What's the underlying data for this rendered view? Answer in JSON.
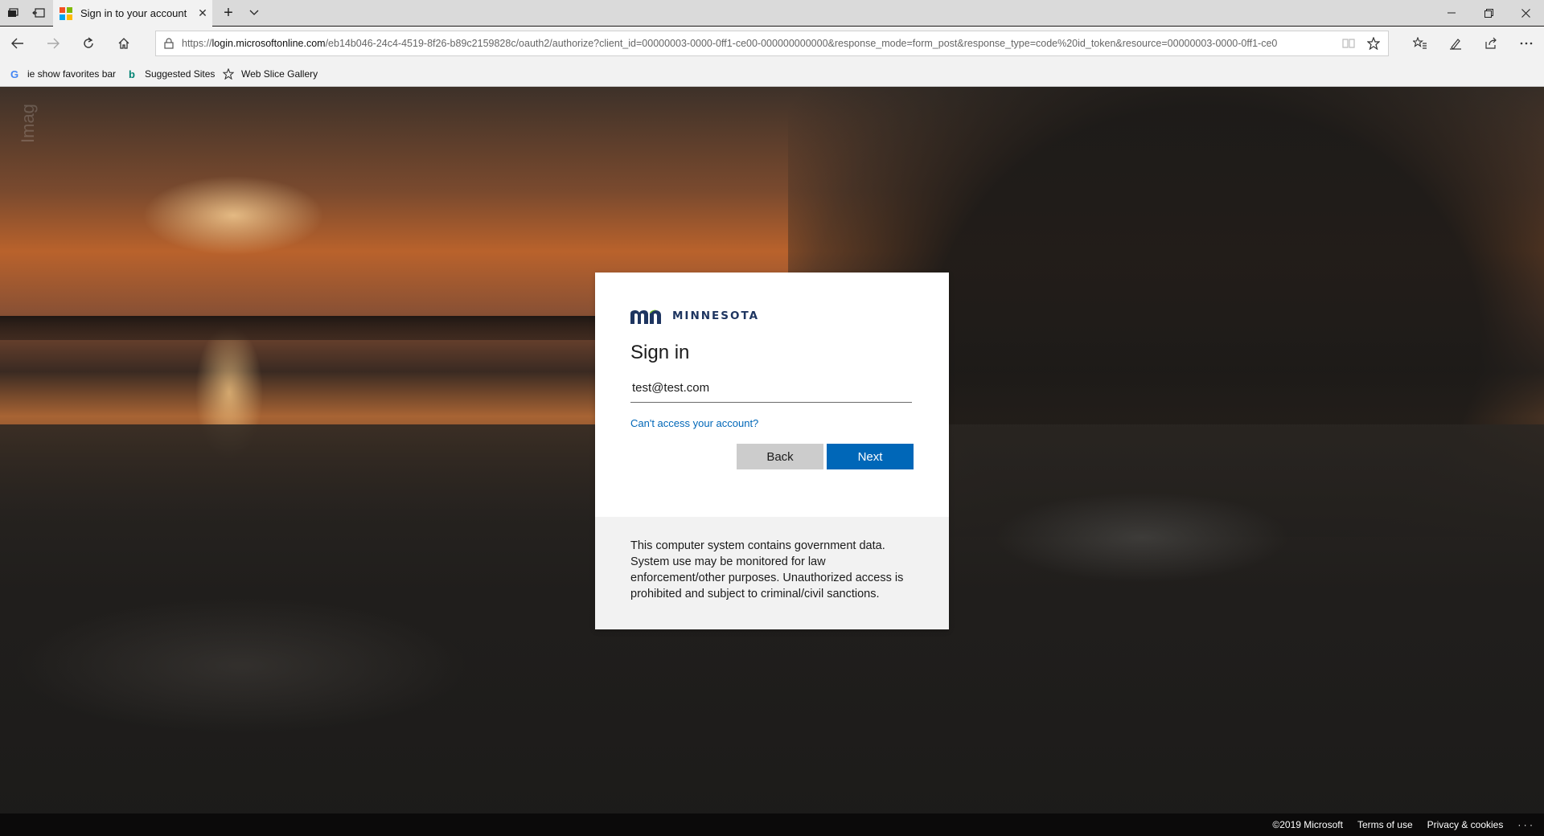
{
  "browser": {
    "tab": {
      "title": "Sign in to your account",
      "close": "✕"
    },
    "new_tab": "+",
    "url": {
      "scheme": "https://",
      "host": "login.microsoftonline.com",
      "path": "/eb14b046-24c4-4519-8f26-b89c2159828c/oauth2/authorize?client_id=00000003-0000-0ff1-ce00-000000000000&response_mode=form_post&response_type=code%20id_token&resource=00000003-0000-0ff1-ce0"
    },
    "favorites": [
      {
        "label": "ie show favorites bar",
        "icon": "google-icon"
      },
      {
        "label": "Suggested Sites",
        "icon": "bing-icon"
      },
      {
        "label": "Web Slice Gallery",
        "icon": "star-icon"
      }
    ]
  },
  "page": {
    "watermark": "Imag"
  },
  "signin": {
    "logo_text": "MINNESOTA",
    "heading": "Sign in",
    "email_value": "test@test.com",
    "cant_access": "Can't access your account?",
    "back_label": "Back",
    "next_label": "Next",
    "notice": "This computer system contains government data. System use may be monitored for law enforcement/other purposes. Unauthorized access is prohibited and subject to criminal/civil sanctions."
  },
  "footer": {
    "copyright": "©2019 Microsoft",
    "terms": "Terms of use",
    "privacy": "Privacy & cookies",
    "more": "· · ·"
  },
  "colors": {
    "accent": "#0067b8",
    "logo_blue": "#1e3560",
    "logo_green": "#78be20"
  }
}
